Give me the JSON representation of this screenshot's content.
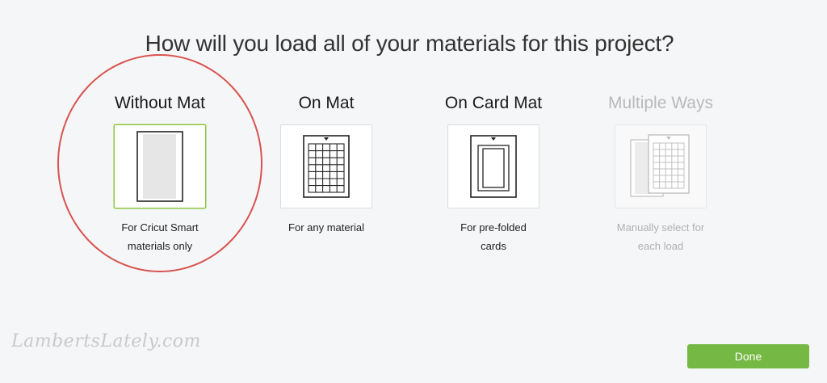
{
  "title": "How will you load all of your materials for this project?",
  "options": [
    {
      "label": "Without Mat",
      "desc_line1": "For Cricut Smart",
      "desc_line2": "materials only",
      "icon": "smart-material-icon",
      "state": "selected"
    },
    {
      "label": "On Mat",
      "desc_line1": "For any material",
      "desc_line2": "",
      "icon": "cutting-mat-icon",
      "state": "normal"
    },
    {
      "label": "On Card Mat",
      "desc_line1": "For pre-folded",
      "desc_line2": "cards",
      "icon": "card-mat-icon",
      "state": "normal"
    },
    {
      "label": "Multiple Ways",
      "desc_line1": "Manually select for",
      "desc_line2": "each load",
      "icon": "multiple-mats-icon",
      "state": "disabled"
    }
  ],
  "done_label": "Done",
  "watermark": "LambertsLately.com",
  "colors": {
    "background": "#f5f6f8",
    "accent_green": "#75b844",
    "selected_border": "#8dc63f",
    "highlight_circle": "#d9534f"
  }
}
